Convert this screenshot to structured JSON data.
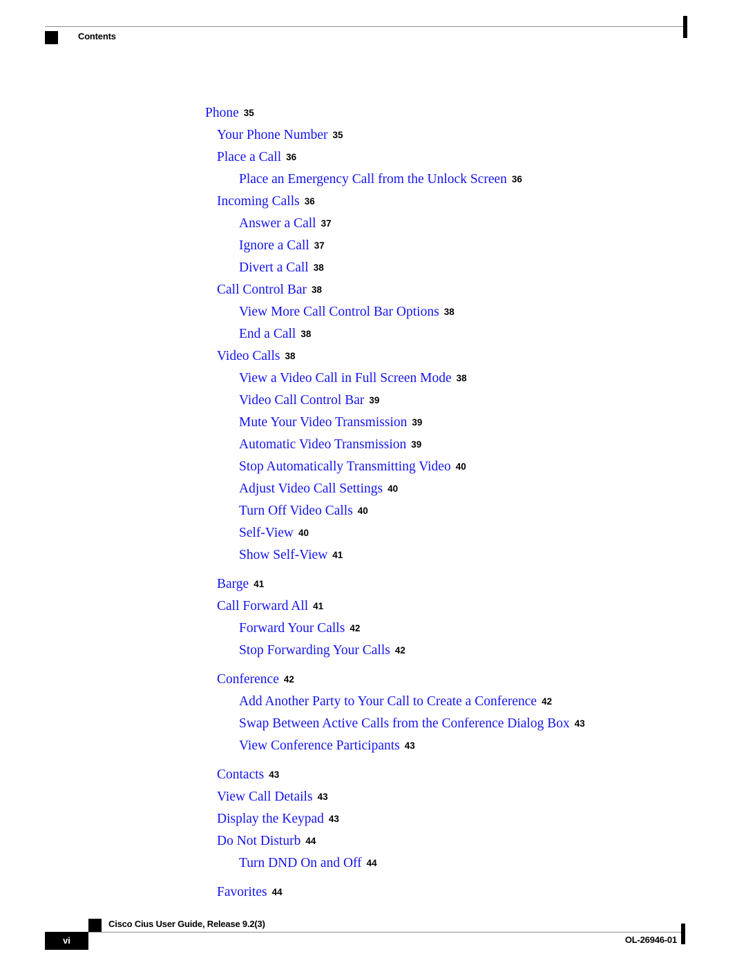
{
  "header": {
    "section_label": "Contents"
  },
  "toc": {
    "entries": [
      {
        "level": 1,
        "title": "Phone",
        "page": "35",
        "gap_before": false
      },
      {
        "level": 2,
        "title": "Your Phone Number",
        "page": "35",
        "gap_before": false
      },
      {
        "level": 2,
        "title": "Place a Call",
        "page": "36",
        "gap_before": false
      },
      {
        "level": 3,
        "title": "Place an Emergency Call from the Unlock Screen",
        "page": "36",
        "gap_before": false
      },
      {
        "level": 2,
        "title": "Incoming Calls",
        "page": "36",
        "gap_before": false
      },
      {
        "level": 3,
        "title": "Answer a Call",
        "page": "37",
        "gap_before": false
      },
      {
        "level": 3,
        "title": "Ignore a Call",
        "page": "37",
        "gap_before": false
      },
      {
        "level": 3,
        "title": "Divert a Call",
        "page": "38",
        "gap_before": false
      },
      {
        "level": 2,
        "title": "Call Control Bar",
        "page": "38",
        "gap_before": false
      },
      {
        "level": 3,
        "title": "View More Call Control Bar Options",
        "page": "38",
        "gap_before": false
      },
      {
        "level": 3,
        "title": "End a Call",
        "page": "38",
        "gap_before": false
      },
      {
        "level": 2,
        "title": "Video Calls",
        "page": "38",
        "gap_before": false
      },
      {
        "level": 3,
        "title": "View a Video Call in Full Screen Mode",
        "page": "38",
        "gap_before": false
      },
      {
        "level": 3,
        "title": "Video Call Control Bar",
        "page": "39",
        "gap_before": false
      },
      {
        "level": 3,
        "title": "Mute Your Video Transmission",
        "page": "39",
        "gap_before": false
      },
      {
        "level": 3,
        "title": "Automatic Video Transmission",
        "page": "39",
        "gap_before": false
      },
      {
        "level": 3,
        "title": "Stop Automatically Transmitting Video",
        "page": "40",
        "gap_before": false
      },
      {
        "level": 3,
        "title": "Adjust Video Call Settings",
        "page": "40",
        "gap_before": false
      },
      {
        "level": 3,
        "title": "Turn Off Video Calls",
        "page": "40",
        "gap_before": false
      },
      {
        "level": 3,
        "title": "Self-View",
        "page": "40",
        "gap_before": false
      },
      {
        "level": 3,
        "title": "Show Self-View",
        "page": "41",
        "gap_before": false
      },
      {
        "level": 2,
        "title": "Barge",
        "page": "41",
        "gap_before": true
      },
      {
        "level": 2,
        "title": "Call Forward All",
        "page": "41",
        "gap_before": false
      },
      {
        "level": 3,
        "title": "Forward Your Calls",
        "page": "42",
        "gap_before": false
      },
      {
        "level": 3,
        "title": "Stop Forwarding Your Calls",
        "page": "42",
        "gap_before": false
      },
      {
        "level": 2,
        "title": "Conference",
        "page": "42",
        "gap_before": true
      },
      {
        "level": 3,
        "title": "Add Another Party to Your Call to Create a Conference",
        "page": "42",
        "gap_before": false
      },
      {
        "level": 3,
        "title": "Swap Between Active Calls from the Conference Dialog Box",
        "page": "43",
        "gap_before": false
      },
      {
        "level": 3,
        "title": "View Conference Participants",
        "page": "43",
        "gap_before": false
      },
      {
        "level": 2,
        "title": "Contacts",
        "page": "43",
        "gap_before": true
      },
      {
        "level": 2,
        "title": "View Call Details",
        "page": "43",
        "gap_before": false
      },
      {
        "level": 2,
        "title": "Display the Keypad",
        "page": "43",
        "gap_before": false
      },
      {
        "level": 2,
        "title": "Do Not Disturb",
        "page": "44",
        "gap_before": false
      },
      {
        "level": 3,
        "title": "Turn DND On and Off",
        "page": "44",
        "gap_before": false
      },
      {
        "level": 2,
        "title": "Favorites",
        "page": "44",
        "gap_before": true
      }
    ]
  },
  "footer": {
    "guide_title": "Cisco Cius User Guide, Release 9.2(3)",
    "page_number": "vi",
    "document_id": "OL-26946-01"
  },
  "colors": {
    "link_blue": "#1414f0",
    "rule_gray": "#8c8c8c",
    "marker_black": "#000000"
  }
}
